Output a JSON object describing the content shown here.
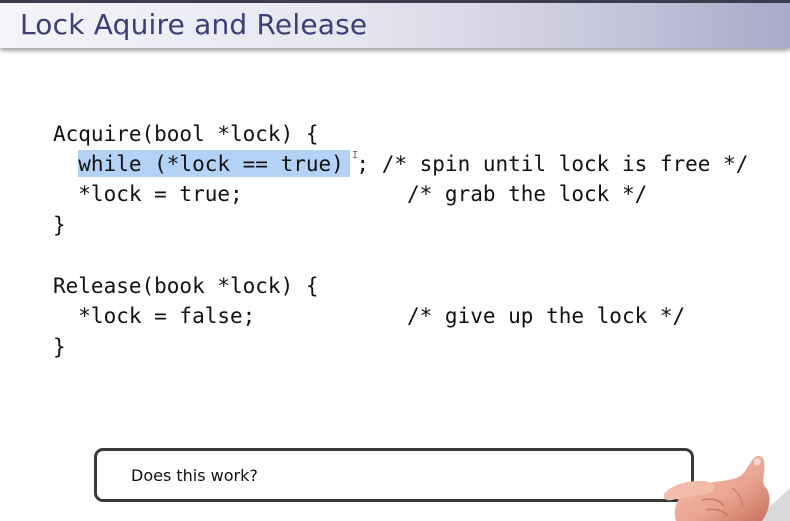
{
  "slide": {
    "title": "Lock Aquire and Release"
  },
  "code": {
    "lines": [
      "Acquire(bool *lock) {",
      "  while (*lock == true) ; /* spin until lock is free */",
      "  *lock = true;             /* grab the lock */",
      "}",
      "",
      "Release(book *lock) {",
      "  *lock = false;            /* give up the lock */",
      "}"
    ],
    "cursor_glyph": "I"
  },
  "callout": {
    "text": "Does this work?"
  },
  "icons": {
    "pointer": "hand-pointer-icon"
  },
  "colors": {
    "title_text": "#3d3d78",
    "selection": "#b4d2f5",
    "title_bar_end": "#a9a9c9"
  }
}
